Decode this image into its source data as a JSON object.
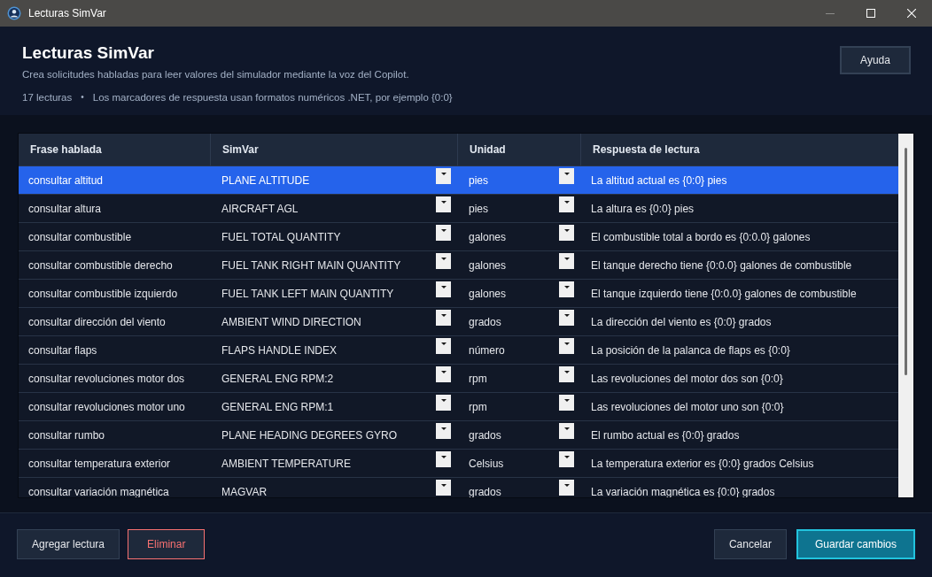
{
  "window": {
    "title": "Lecturas SimVar",
    "controls": [
      {
        "kind": "minimize",
        "disabled": true
      },
      {
        "kind": "maximize",
        "disabled": false
      },
      {
        "kind": "close",
        "disabled": false
      }
    ]
  },
  "header": {
    "title": "Lecturas SimVar",
    "subtitle": "Crea solicitudes habladas para leer valores del simulador mediante la voz del Copilot.",
    "count": "17 lecturas",
    "separator": "•",
    "note": "Los marcadores de respuesta usan formatos numéricos .NET, por ejemplo {0:0}",
    "help_button": "Ayuda"
  },
  "table": {
    "columns": [
      "Frase hablada",
      "SimVar",
      "Unidad",
      "Respuesta de lectura"
    ],
    "rows": [
      {
        "phrase": "consultar altitud",
        "simvar": "PLANE ALTITUDE",
        "unit": "pies",
        "response": "La altitud actual es {0:0} pies",
        "selected": true
      },
      {
        "phrase": "consultar altura",
        "simvar": "AIRCRAFT AGL",
        "unit": "pies",
        "response": "La altura es {0:0} pies",
        "selected": false
      },
      {
        "phrase": "consultar combustible",
        "simvar": "FUEL TOTAL QUANTITY",
        "unit": "galones",
        "response": "El combustible total a bordo es {0:0.0} galones",
        "selected": false
      },
      {
        "phrase": "consultar combustible derecho",
        "simvar": "FUEL TANK RIGHT MAIN QUANTITY",
        "unit": "galones",
        "response": "El tanque derecho tiene {0:0.0} galones de combustible",
        "selected": false
      },
      {
        "phrase": "consultar combustible izquierdo",
        "simvar": "FUEL TANK LEFT MAIN QUANTITY",
        "unit": "galones",
        "response": "El tanque izquierdo tiene {0:0.0} galones de combustible",
        "selected": false
      },
      {
        "phrase": "consultar dirección del viento",
        "simvar": "AMBIENT WIND DIRECTION",
        "unit": "grados",
        "response": "La dirección del viento es {0:0} grados",
        "selected": false
      },
      {
        "phrase": "consultar flaps",
        "simvar": "FLAPS HANDLE INDEX",
        "unit": "número",
        "response": "La posición de la palanca de flaps es {0:0}",
        "selected": false
      },
      {
        "phrase": "consultar revoluciones motor dos",
        "simvar": "GENERAL ENG RPM:2",
        "unit": "rpm",
        "response": "Las revoluciones del motor dos son {0:0}",
        "selected": false
      },
      {
        "phrase": "consultar revoluciones motor uno",
        "simvar": "GENERAL ENG RPM:1",
        "unit": "rpm",
        "response": "Las revoluciones del motor uno son {0:0}",
        "selected": false
      },
      {
        "phrase": "consultar rumbo",
        "simvar": "PLANE HEADING DEGREES GYRO",
        "unit": "grados",
        "response": "El rumbo actual es {0:0} grados",
        "selected": false
      },
      {
        "phrase": "consultar temperatura exterior",
        "simvar": "AMBIENT TEMPERATURE",
        "unit": "Celsius",
        "response": "La temperatura exterior es {0:0} grados Celsius",
        "selected": false
      },
      {
        "phrase": "consultar variación magnética",
        "simvar": "MAGVAR",
        "unit": "grados",
        "response": "La variación magnética es {0:0} grados",
        "selected": false
      }
    ]
  },
  "footer": {
    "left_buttons": [
      {
        "label": "Agregar lectura",
        "kind": "default"
      },
      {
        "label": "Eliminar",
        "kind": "danger"
      }
    ],
    "right_buttons": [
      {
        "label": "Cancelar",
        "kind": "default"
      },
      {
        "label": "Guardar cambios",
        "kind": "primary"
      }
    ]
  }
}
